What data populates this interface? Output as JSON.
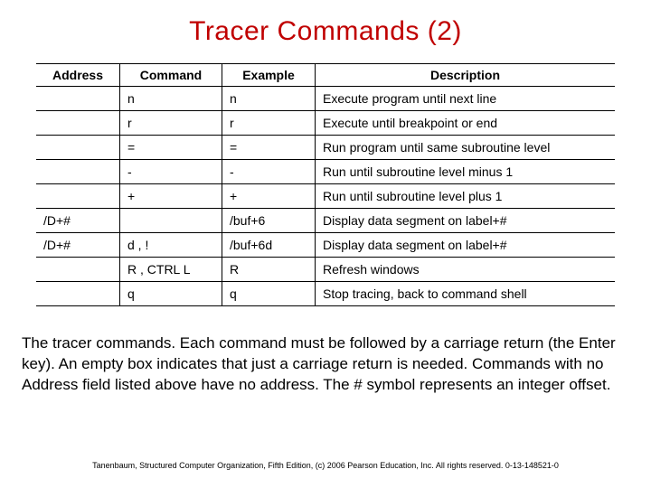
{
  "title": "Tracer Commands (2)",
  "headers": {
    "address": "Address",
    "command": "Command",
    "example": "Example",
    "description": "Description"
  },
  "rows": [
    {
      "address": "",
      "command": "n",
      "example": "n",
      "description": "Execute program until next line"
    },
    {
      "address": "",
      "command": "r",
      "example": "r",
      "description": "Execute until breakpoint or end"
    },
    {
      "address": "",
      "command": "=",
      "example": "=",
      "description": "Run program until same subroutine level"
    },
    {
      "address": "",
      "command": "-",
      "example": "-",
      "description": "Run until subroutine level minus 1"
    },
    {
      "address": "",
      "command": "+",
      "example": "+",
      "description": "Run until subroutine level plus 1"
    },
    {
      "address": "/D+#",
      "command": "",
      "example": "/buf+6",
      "description": "Display data segment on label+#"
    },
    {
      "address": "/D+#",
      "command": "d , !",
      "example": "/buf+6d",
      "description": "Display data segment on label+#"
    },
    {
      "address": "",
      "command": "R , CTRL L",
      "example": "R",
      "description": "Refresh windows"
    },
    {
      "address": "",
      "command": "q",
      "example": "q",
      "description": "Stop tracing, back to command shell"
    }
  ],
  "caption": "The tracer commands. Each command must be followed by a carriage return (the Enter key). An empty box indicates that just a carriage return is needed. Commands with no Address field listed above have no address. The # symbol represents an integer offset.",
  "footer": "Tanenbaum, Structured Computer Organization, Fifth Edition, (c) 2006 Pearson Education, Inc. All rights reserved. 0-13-148521-0"
}
